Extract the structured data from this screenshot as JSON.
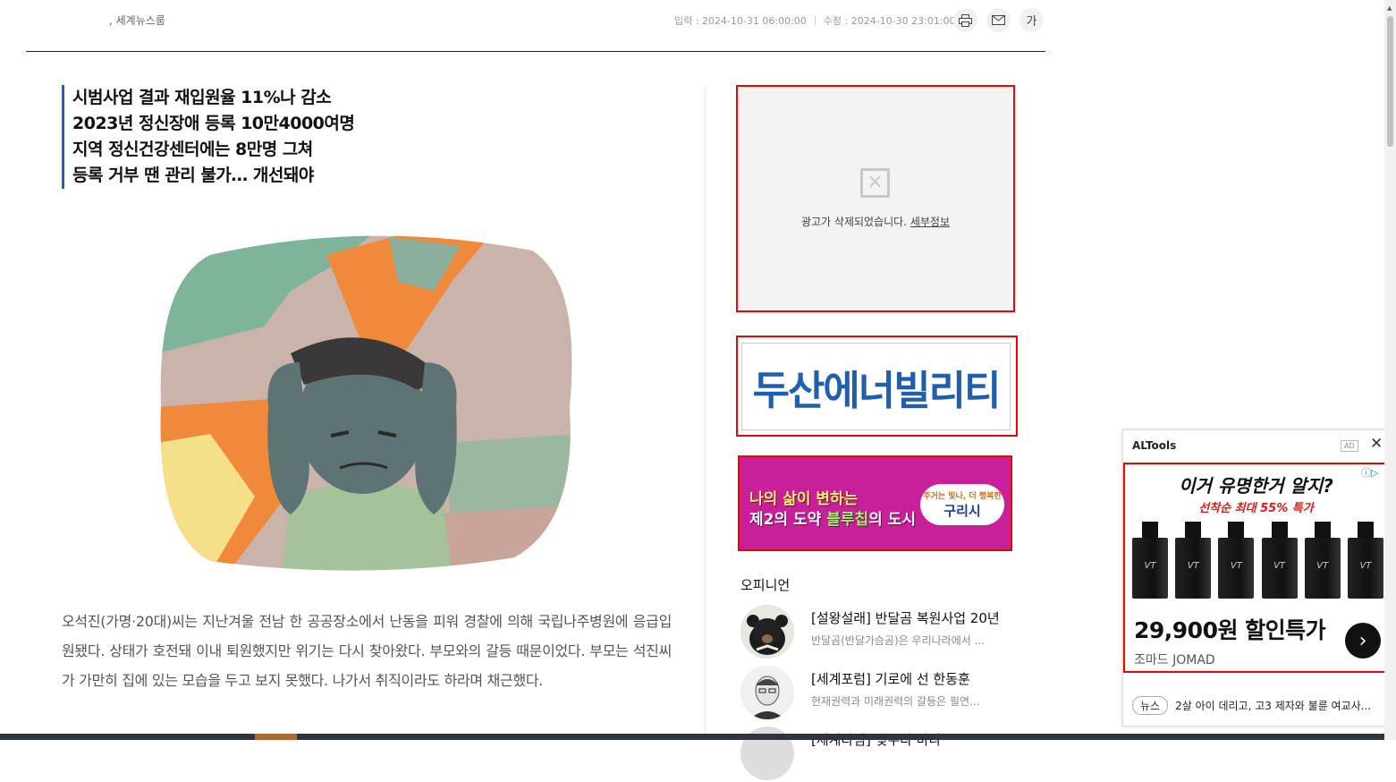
{
  "header": {
    "byline": ", 세계뉴스룸",
    "date_input": "입력 : 2024-10-31 06:00:00",
    "date_edit": "수정 : 2024-10-30 23:01:00",
    "print_icon": "printer-icon",
    "mail_icon": "envelope-icon",
    "font_size_label": "가"
  },
  "subtitle": [
    "시범사업 결과 재입원율 11%나 감소",
    "2023년 정신장애 등록 10만4000여명",
    "지역 정신건강센터에는 8만명 그쳐",
    "등록 거부 땐 관리 불가… 개선돼야"
  ],
  "article": {
    "body": "오석진(가명·20대)씨는 지난겨울 전남 한 공공장소에서 난동을 피워 경찰에 의해 국립나주병원에 응급입원됐다. 상태가 호전돼 이내 퇴원했지만 위기는 다시 찾아왔다. 부모와의 갈등 때문이었다. 부모는 석진씨가 가만히 집에 있는 모습을 두고 보지 못했다. 나가서 취직이라도 하라며 채근했다."
  },
  "ads": {
    "removed_message": "광고가 삭제되었습니다.",
    "removed_link": "세부정보",
    "doosan": "두산에너빌리티",
    "gurye_line1": "나의 삶이 변하는",
    "gurye_line2a": "제2의 도약 ",
    "gurye_line2b": "블루칩",
    "gurye_line2c": "의 도시",
    "gurye_slogan": "주거는 빛나, 더 행복한",
    "gurye_logo": "구리시"
  },
  "opinion": {
    "title": "오피니언",
    "items": [
      {
        "title": "[설왕설래] 반달곰 복원사업 20년",
        "desc": "반달곰(반달가슴곰)은 우리나라에서 ..."
      },
      {
        "title": "[세계포럼] 기로에 선 한동훈",
        "desc": "현재권력과 미래권력의 갈등은 필연..."
      },
      {
        "title": "[세계타임] 잊무다 마나",
        "desc": ""
      }
    ]
  },
  "altools": {
    "title": "ALTools",
    "ad_tag": "AD",
    "headline": "이거 유명한거 알지?",
    "subhead": "선착순 최대 55% 특가",
    "bottle_label": "VT",
    "price": "29,900원 할인특가",
    "brand": "조마드 JOMAD",
    "news_tag": "뉴스",
    "news_text": "2살 아이 데리고, 고3 제자와 불륜 여교사..."
  },
  "colors": {
    "accent_blue": "#2b5bb8",
    "ad_border": "#ee0000",
    "doosan_blue": "#1f5fae",
    "gurye_magenta": "#c8209a"
  }
}
